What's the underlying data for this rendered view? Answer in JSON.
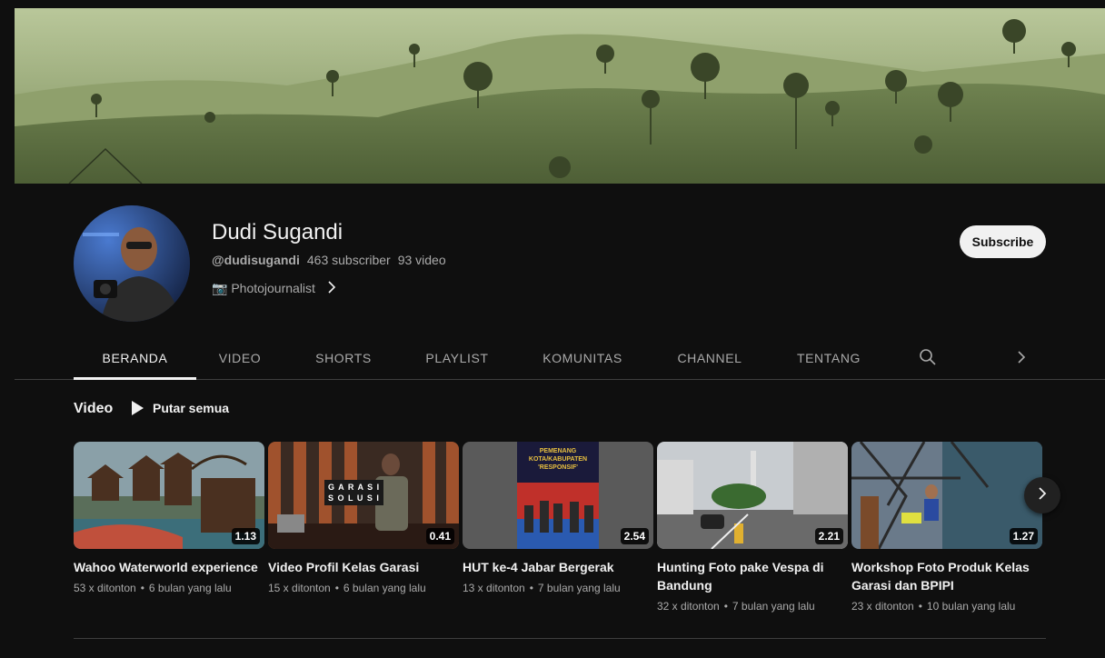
{
  "channel": {
    "name": "Dudi Sugandi",
    "handle": "@dudisugandi",
    "subscribers": "463 subscriber",
    "videos": "93 video",
    "description": "📷 Photojournalist",
    "subscribe_label": "Subscribe"
  },
  "tabs": [
    {
      "label": "BERANDA",
      "active": true
    },
    {
      "label": "VIDEO",
      "active": false
    },
    {
      "label": "SHORTS",
      "active": false
    },
    {
      "label": "PLAYLIST",
      "active": false
    },
    {
      "label": "KOMUNITAS",
      "active": false
    },
    {
      "label": "CHANNEL",
      "active": false
    },
    {
      "label": "TENTANG",
      "active": false
    }
  ],
  "section": {
    "title": "Video",
    "play_all": "Putar semua"
  },
  "videos": [
    {
      "title": "Wahoo Waterworld experience",
      "duration": "1.13",
      "views": "53 x ditonton",
      "age": "6 bulan yang lalu"
    },
    {
      "title": "Video Profil Kelas Garasi",
      "duration": "0.41",
      "views": "15 x ditonton",
      "age": "6 bulan yang lalu"
    },
    {
      "title": "HUT ke-4 Jabar Bergerak",
      "duration": "2.54",
      "views": "13 x ditonton",
      "age": "7 bulan yang lalu"
    },
    {
      "title": "Hunting Foto pake Vespa di Bandung",
      "duration": "2.21",
      "views": "32 x ditonton",
      "age": "7 bulan yang lalu"
    },
    {
      "title": "Workshop Foto Produk Kelas Garasi dan BPIPI",
      "duration": "1.27",
      "views": "23 x ditonton",
      "age": "10 bulan yang lalu"
    }
  ],
  "thumb_text": {
    "garasi_line1": "G A R A S I",
    "garasi_line2": "S O L U S I",
    "hut_line1": "PEMENANG",
    "hut_line2": "KOTA/KABUPATEN",
    "hut_line3": "'RESPONSIF'"
  },
  "colors": {
    "background": "#0f0f0f",
    "text_primary": "#f1f1f1",
    "text_secondary": "#aaaaaa",
    "subscribe_bg": "#f1f1f1",
    "divider": "#3f3f3f"
  }
}
